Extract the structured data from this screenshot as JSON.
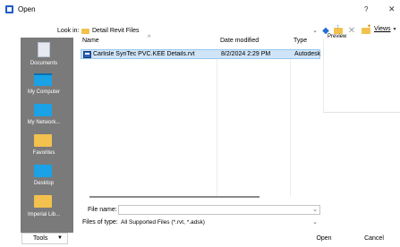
{
  "window": {
    "title": "Open",
    "help_glyph": "?",
    "close_glyph": "✕"
  },
  "toolbar": {
    "look_in_label": "Look in:",
    "look_in_value": "Detail Revit Files",
    "back_glyph": "◆",
    "delete_glyph": "✕",
    "views_label": "Views"
  },
  "places": [
    {
      "label": "Documents",
      "icon": "documents-icon"
    },
    {
      "label": "My Computer",
      "icon": "computer-icon"
    },
    {
      "label": "My Network...",
      "icon": "network-icon"
    },
    {
      "label": "Favorites",
      "icon": "folder-icon"
    },
    {
      "label": "Desktop",
      "icon": "desktop-icon"
    },
    {
      "label": "Imperial Lib...",
      "icon": "folder-icon"
    }
  ],
  "file_list": {
    "columns": [
      "Name",
      "Date modified",
      "Type"
    ],
    "sort_glyph": "^",
    "rows": [
      {
        "name": "Carlisle SynTec  PVC.KEE Details.rvt",
        "date": "8/2/2024 2:29 PM",
        "type": "Autodesk"
      }
    ]
  },
  "preview": {
    "label": "Preview"
  },
  "fields": {
    "file_name_label": "File name:",
    "file_name_value": "",
    "files_of_type_label": "Files of type:",
    "files_of_type_value": "All Supported Files  (*.rvt, *.adsk)"
  },
  "buttons": {
    "tools_label": "Tools",
    "open_label": "Open",
    "cancel_label": "Cancel"
  },
  "colors": {
    "selection": "#cfe4f7",
    "places_bg": "#7a7a7a",
    "folder": "#f2c14e",
    "accent_blue": "#1f6fd6"
  }
}
